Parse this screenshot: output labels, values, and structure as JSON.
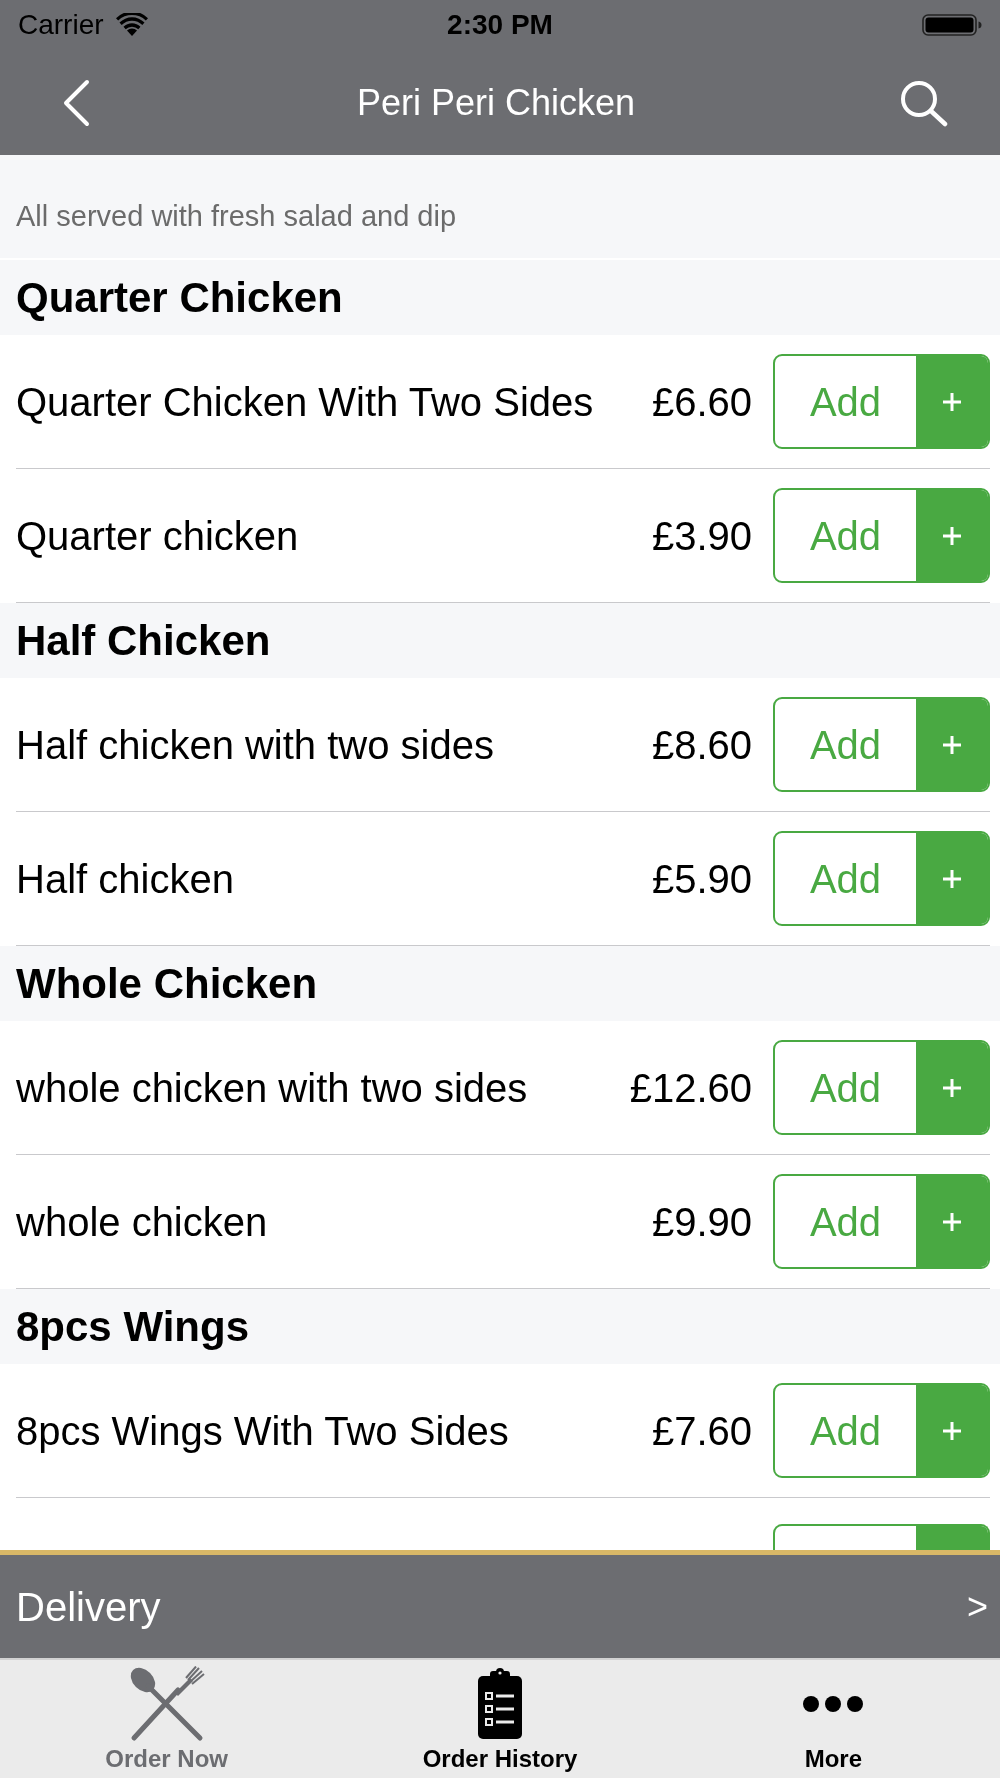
{
  "status_bar": {
    "carrier": "Carrier",
    "time": "2:30 PM"
  },
  "nav_bar": {
    "title": "Peri Peri Chicken"
  },
  "subtitle": "All served with fresh salad and dip",
  "sections": [
    {
      "title": "Quarter Chicken",
      "items": [
        {
          "kind": "item",
          "name": "Quarter Chicken With Two Sides",
          "price": "£6.60",
          "button": "Add"
        },
        {
          "kind": "item",
          "name": "Quarter chicken",
          "price": "£3.90",
          "button": "Add"
        }
      ]
    },
    {
      "title": "Half Chicken",
      "items": [
        {
          "kind": "item",
          "name": "Half chicken with two sides",
          "price": "£8.60",
          "button": "Add"
        },
        {
          "kind": "item",
          "name": "Half chicken",
          "price": "£5.90",
          "button": "Add"
        }
      ]
    },
    {
      "title": "Whole Chicken",
      "items": [
        {
          "kind": "item",
          "name": "whole chicken with two sides",
          "price": "£12.60",
          "button": "Add"
        },
        {
          "kind": "item",
          "name": "whole chicken",
          "price": "£9.90",
          "button": "Add"
        }
      ]
    },
    {
      "title": "8pcs Wings",
      "items": [
        {
          "kind": "item",
          "name": "8pcs Wings With Two Sides",
          "price": "£7.60",
          "button": "Add"
        },
        {
          "kind": "cut_off"
        }
      ]
    }
  ],
  "order_bar": {
    "label": "Delivery",
    "arrow": ">"
  },
  "tab_bar": [
    {
      "label": "Order Now",
      "selected": true
    },
    {
      "label": "Order History",
      "selected": false
    },
    {
      "label": "More",
      "selected": false
    }
  ]
}
